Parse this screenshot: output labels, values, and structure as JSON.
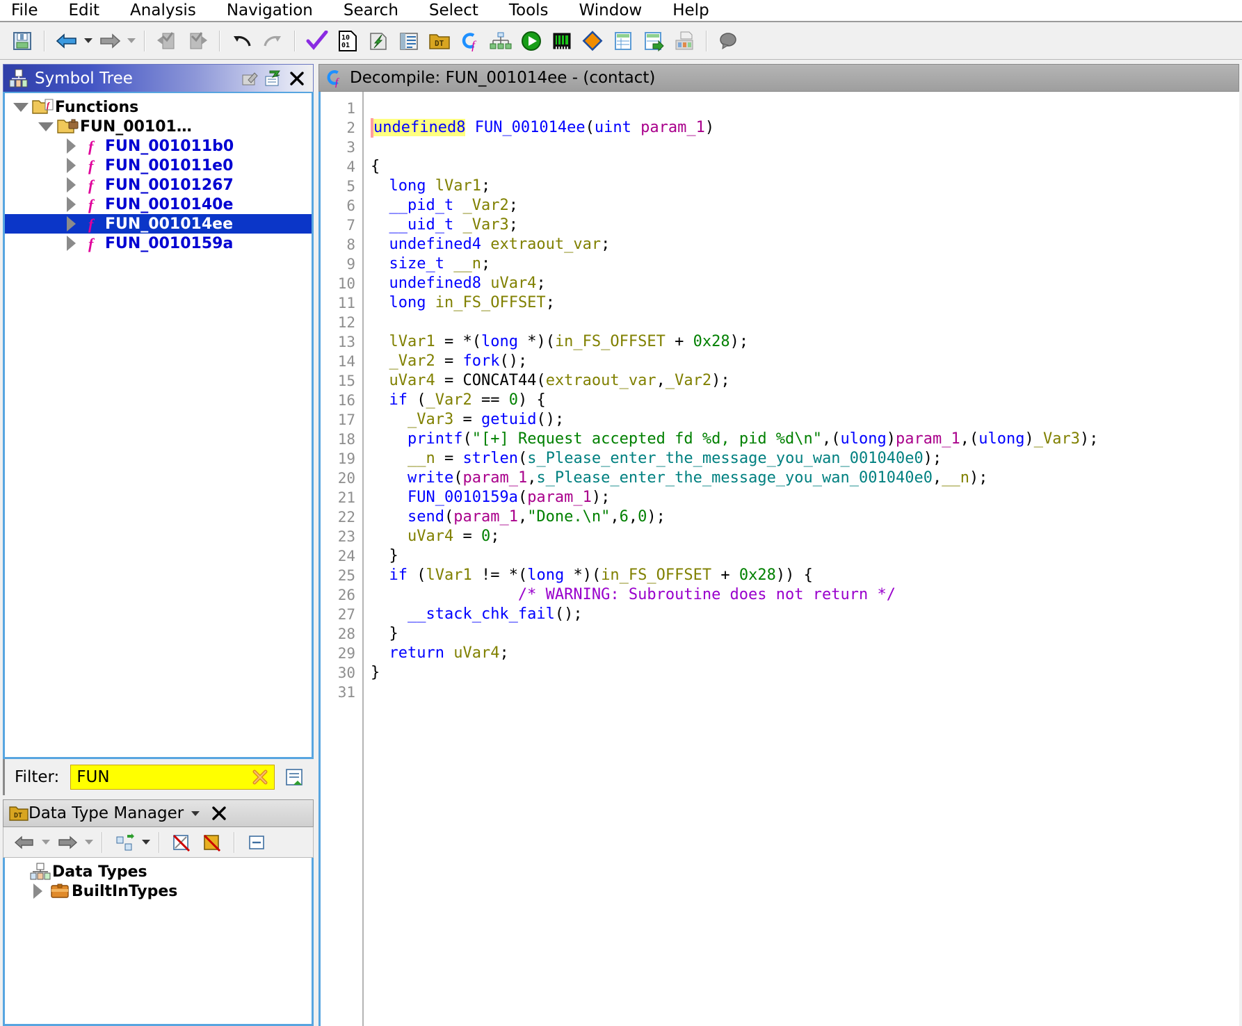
{
  "menubar": {
    "items": [
      {
        "label": "File",
        "name": "menu-file"
      },
      {
        "label": "Edit",
        "name": "menu-edit"
      },
      {
        "label": "Analysis",
        "name": "menu-analysis"
      },
      {
        "label": "Navigation",
        "name": "menu-navigation"
      },
      {
        "label": "Search",
        "name": "menu-search"
      },
      {
        "label": "Select",
        "name": "menu-select"
      },
      {
        "label": "Tools",
        "name": "menu-tools"
      },
      {
        "label": "Window",
        "name": "menu-window"
      },
      {
        "label": "Help",
        "name": "menu-help"
      }
    ]
  },
  "toolbar": {
    "icons": [
      "save-icon",
      "back-arrow-icon",
      "back-dropdown-icon",
      "forward-arrow-icon",
      "forward-dropdown-icon",
      "undo-stack-icon",
      "redo-stack-icon",
      "undo-icon",
      "redo-icon",
      "analyze-checkmark-icon",
      "binary-file-icon",
      "import-icon",
      "listing-icon",
      "data-type-manager-icon",
      "decompiler-icon",
      "function-graph-icon",
      "run-icon",
      "memory-map-icon",
      "diff-icon",
      "table-icon",
      "table-export-icon",
      "snapshot-icon",
      "comment-icon"
    ]
  },
  "symbol_tree": {
    "title": "Symbol Tree",
    "tools": [
      "edit-icon",
      "navigate-icon",
      "close-icon"
    ],
    "nodes": [
      {
        "label": "Functions",
        "name": "tree-node-functions",
        "indent": 0,
        "twist": "down",
        "icon": "folder-functions-icon",
        "kind": "folder",
        "selected": false
      },
      {
        "label": "FUN_00101…",
        "name": "tree-node-fun-00101",
        "indent": 1,
        "twist": "down",
        "icon": "folder-namespace-icon",
        "kind": "folder",
        "selected": false
      },
      {
        "label": "FUN_001011b0",
        "name": "tree-node-fun-001011b0",
        "indent": 2,
        "twist": "right",
        "icon": "function-icon",
        "kind": "function",
        "selected": false
      },
      {
        "label": "FUN_001011e0",
        "name": "tree-node-fun-001011e0",
        "indent": 2,
        "twist": "right",
        "icon": "function-icon",
        "kind": "function",
        "selected": false
      },
      {
        "label": "FUN_00101267",
        "name": "tree-node-fun-00101267",
        "indent": 2,
        "twist": "right",
        "icon": "function-icon",
        "kind": "function",
        "selected": false
      },
      {
        "label": "FUN_0010140e",
        "name": "tree-node-fun-0010140e",
        "indent": 2,
        "twist": "right",
        "icon": "function-icon",
        "kind": "function",
        "selected": false
      },
      {
        "label": "FUN_001014ee",
        "name": "tree-node-fun-001014ee",
        "indent": 2,
        "twist": "right",
        "icon": "function-icon",
        "kind": "function",
        "selected": true
      },
      {
        "label": "FUN_0010159a",
        "name": "tree-node-fun-0010159a",
        "indent": 2,
        "twist": "right",
        "icon": "function-icon",
        "kind": "function",
        "selected": false
      }
    ]
  },
  "filter": {
    "label": "Filter:",
    "value": "FUN",
    "placeholder": "",
    "clear_icon": "clear-filter-icon",
    "options_icon": "filter-options-icon"
  },
  "data_type_manager": {
    "title": "Data Type Manager",
    "tools": [
      "dropdown-icon",
      "close-icon"
    ],
    "toolbar_icons": [
      "back-arrow-icon",
      "back-dropdown-icon",
      "forward-arrow-icon",
      "forward-dropdown-icon",
      "new-category-icon",
      "new-category-dropdown-icon",
      "filter-pointers-icon",
      "filter-arrays-icon",
      "collapse-all-icon"
    ],
    "nodes": [
      {
        "label": "Data Types",
        "name": "dtm-node-data-types",
        "indent": 0,
        "twist": "none",
        "icon": "data-types-root-icon"
      },
      {
        "label": "BuiltInTypes",
        "name": "dtm-node-builtintypes",
        "indent": 1,
        "twist": "right",
        "icon": "archive-icon"
      }
    ]
  },
  "decompiler": {
    "title": "Decompile: FUN_001014ee -  (contact)",
    "icon": "decompiler-icon",
    "function_name": "FUN_001014ee",
    "program_name": "contact",
    "total_lines": 31,
    "lines": [
      {
        "n": 1,
        "tokens": []
      },
      {
        "n": 2,
        "tokens": [
          {
            "t": "caret",
            "v": " "
          },
          {
            "t": "type hl",
            "v": "undefined8"
          },
          {
            "t": "plain",
            "v": " "
          },
          {
            "t": "fn",
            "v": "FUN_001014ee"
          },
          {
            "t": "plain",
            "v": "("
          },
          {
            "t": "type",
            "v": "uint"
          },
          {
            "t": "plain",
            "v": " "
          },
          {
            "t": "param",
            "v": "param_1"
          },
          {
            "t": "plain",
            "v": ")"
          }
        ]
      },
      {
        "n": 3,
        "tokens": []
      },
      {
        "n": 4,
        "tokens": [
          {
            "t": "plain",
            "v": "{"
          }
        ]
      },
      {
        "n": 5,
        "tokens": [
          {
            "t": "plain",
            "v": "  "
          },
          {
            "t": "type",
            "v": "long"
          },
          {
            "t": "plain",
            "v": " "
          },
          {
            "t": "var",
            "v": "lVar1"
          },
          {
            "t": "plain",
            "v": ";"
          }
        ]
      },
      {
        "n": 6,
        "tokens": [
          {
            "t": "plain",
            "v": "  "
          },
          {
            "t": "type",
            "v": "__pid_t"
          },
          {
            "t": "plain",
            "v": " "
          },
          {
            "t": "var",
            "v": "_Var2"
          },
          {
            "t": "plain",
            "v": ";"
          }
        ]
      },
      {
        "n": 7,
        "tokens": [
          {
            "t": "plain",
            "v": "  "
          },
          {
            "t": "type",
            "v": "__uid_t"
          },
          {
            "t": "plain",
            "v": " "
          },
          {
            "t": "var",
            "v": "_Var3"
          },
          {
            "t": "plain",
            "v": ";"
          }
        ]
      },
      {
        "n": 8,
        "tokens": [
          {
            "t": "plain",
            "v": "  "
          },
          {
            "t": "type",
            "v": "undefined4"
          },
          {
            "t": "plain",
            "v": " "
          },
          {
            "t": "var",
            "v": "extraout_var"
          },
          {
            "t": "plain",
            "v": ";"
          }
        ]
      },
      {
        "n": 9,
        "tokens": [
          {
            "t": "plain",
            "v": "  "
          },
          {
            "t": "type",
            "v": "size_t"
          },
          {
            "t": "plain",
            "v": " "
          },
          {
            "t": "var",
            "v": "__n"
          },
          {
            "t": "plain",
            "v": ";"
          }
        ]
      },
      {
        "n": 10,
        "tokens": [
          {
            "t": "plain",
            "v": "  "
          },
          {
            "t": "type",
            "v": "undefined8"
          },
          {
            "t": "plain",
            "v": " "
          },
          {
            "t": "var",
            "v": "uVar4"
          },
          {
            "t": "plain",
            "v": ";"
          }
        ]
      },
      {
        "n": 11,
        "tokens": [
          {
            "t": "plain",
            "v": "  "
          },
          {
            "t": "type",
            "v": "long"
          },
          {
            "t": "plain",
            "v": " "
          },
          {
            "t": "var",
            "v": "in_FS_OFFSET"
          },
          {
            "t": "plain",
            "v": ";"
          }
        ]
      },
      {
        "n": 12,
        "tokens": []
      },
      {
        "n": 13,
        "tokens": [
          {
            "t": "plain",
            "v": "  "
          },
          {
            "t": "var",
            "v": "lVar1"
          },
          {
            "t": "plain",
            "v": " = *("
          },
          {
            "t": "type",
            "v": "long"
          },
          {
            "t": "plain",
            "v": " *)("
          },
          {
            "t": "var",
            "v": "in_FS_OFFSET"
          },
          {
            "t": "plain",
            "v": " + "
          },
          {
            "t": "num",
            "v": "0x28"
          },
          {
            "t": "plain",
            "v": ");"
          }
        ]
      },
      {
        "n": 14,
        "tokens": [
          {
            "t": "plain",
            "v": "  "
          },
          {
            "t": "var",
            "v": "_Var2"
          },
          {
            "t": "plain",
            "v": " = "
          },
          {
            "t": "fn",
            "v": "fork"
          },
          {
            "t": "plain",
            "v": "();"
          }
        ]
      },
      {
        "n": 15,
        "tokens": [
          {
            "t": "plain",
            "v": "  "
          },
          {
            "t": "var",
            "v": "uVar4"
          },
          {
            "t": "plain",
            "v": " = CONCAT44("
          },
          {
            "t": "var",
            "v": "extraout_var"
          },
          {
            "t": "plain",
            "v": ","
          },
          {
            "t": "var",
            "v": "_Var2"
          },
          {
            "t": "plain",
            "v": ");"
          }
        ]
      },
      {
        "n": 16,
        "tokens": [
          {
            "t": "plain",
            "v": "  "
          },
          {
            "t": "kw",
            "v": "if"
          },
          {
            "t": "plain",
            "v": " ("
          },
          {
            "t": "var",
            "v": "_Var2"
          },
          {
            "t": "plain",
            "v": " == "
          },
          {
            "t": "num",
            "v": "0"
          },
          {
            "t": "plain",
            "v": ") {"
          }
        ]
      },
      {
        "n": 17,
        "tokens": [
          {
            "t": "plain",
            "v": "    "
          },
          {
            "t": "var",
            "v": "_Var3"
          },
          {
            "t": "plain",
            "v": " = "
          },
          {
            "t": "fn",
            "v": "getuid"
          },
          {
            "t": "plain",
            "v": "();"
          }
        ]
      },
      {
        "n": 18,
        "tokens": [
          {
            "t": "plain",
            "v": "    "
          },
          {
            "t": "fn",
            "v": "printf"
          },
          {
            "t": "plain",
            "v": "("
          },
          {
            "t": "str",
            "v": "\"[+] Request accepted fd %d, pid %d\\n\""
          },
          {
            "t": "plain",
            "v": ",("
          },
          {
            "t": "type",
            "v": "ulong"
          },
          {
            "t": "plain",
            "v": ")"
          },
          {
            "t": "param",
            "v": "param_1"
          },
          {
            "t": "plain",
            "v": ",("
          },
          {
            "t": "type",
            "v": "ulong"
          },
          {
            "t": "plain",
            "v": ")"
          },
          {
            "t": "var",
            "v": "_Var3"
          },
          {
            "t": "plain",
            "v": ");"
          }
        ]
      },
      {
        "n": 19,
        "tokens": [
          {
            "t": "plain",
            "v": "    "
          },
          {
            "t": "var",
            "v": "__n"
          },
          {
            "t": "plain",
            "v": " = "
          },
          {
            "t": "fn",
            "v": "strlen"
          },
          {
            "t": "plain",
            "v": "("
          },
          {
            "t": "sym",
            "v": "s_Please_enter_the_message_you_wan_001040e0"
          },
          {
            "t": "plain",
            "v": ");"
          }
        ]
      },
      {
        "n": 20,
        "tokens": [
          {
            "t": "plain",
            "v": "    "
          },
          {
            "t": "fn",
            "v": "write"
          },
          {
            "t": "plain",
            "v": "("
          },
          {
            "t": "param",
            "v": "param_1"
          },
          {
            "t": "plain",
            "v": ","
          },
          {
            "t": "sym",
            "v": "s_Please_enter_the_message_you_wan_001040e0"
          },
          {
            "t": "plain",
            "v": ","
          },
          {
            "t": "var",
            "v": "__n"
          },
          {
            "t": "plain",
            "v": ");"
          }
        ]
      },
      {
        "n": 21,
        "tokens": [
          {
            "t": "plain",
            "v": "    "
          },
          {
            "t": "fn",
            "v": "FUN_0010159a"
          },
          {
            "t": "plain",
            "v": "("
          },
          {
            "t": "param",
            "v": "param_1"
          },
          {
            "t": "plain",
            "v": ");"
          }
        ]
      },
      {
        "n": 22,
        "tokens": [
          {
            "t": "plain",
            "v": "    "
          },
          {
            "t": "fn",
            "v": "send"
          },
          {
            "t": "plain",
            "v": "("
          },
          {
            "t": "param",
            "v": "param_1"
          },
          {
            "t": "plain",
            "v": ","
          },
          {
            "t": "str",
            "v": "\"Done.\\n\""
          },
          {
            "t": "plain",
            "v": ","
          },
          {
            "t": "num",
            "v": "6"
          },
          {
            "t": "plain",
            "v": ","
          },
          {
            "t": "num",
            "v": "0"
          },
          {
            "t": "plain",
            "v": ");"
          }
        ]
      },
      {
        "n": 23,
        "tokens": [
          {
            "t": "plain",
            "v": "    "
          },
          {
            "t": "var",
            "v": "uVar4"
          },
          {
            "t": "plain",
            "v": " = "
          },
          {
            "t": "num",
            "v": "0"
          },
          {
            "t": "plain",
            "v": ";"
          }
        ]
      },
      {
        "n": 24,
        "tokens": [
          {
            "t": "plain",
            "v": "  }"
          }
        ]
      },
      {
        "n": 25,
        "tokens": [
          {
            "t": "plain",
            "v": "  "
          },
          {
            "t": "kw",
            "v": "if"
          },
          {
            "t": "plain",
            "v": " ("
          },
          {
            "t": "var",
            "v": "lVar1"
          },
          {
            "t": "plain",
            "v": " != *("
          },
          {
            "t": "type",
            "v": "long"
          },
          {
            "t": "plain",
            "v": " *)("
          },
          {
            "t": "var",
            "v": "in_FS_OFFSET"
          },
          {
            "t": "plain",
            "v": " + "
          },
          {
            "t": "num",
            "v": "0x28"
          },
          {
            "t": "plain",
            "v": ")) {"
          }
        ]
      },
      {
        "n": 26,
        "tokens": [
          {
            "t": "plain",
            "v": "                "
          },
          {
            "t": "cmt",
            "v": "/* WARNING: Subroutine does not return */"
          }
        ]
      },
      {
        "n": 27,
        "tokens": [
          {
            "t": "plain",
            "v": "    "
          },
          {
            "t": "fn",
            "v": "__stack_chk_fail"
          },
          {
            "t": "plain",
            "v": "();"
          }
        ]
      },
      {
        "n": 28,
        "tokens": [
          {
            "t": "plain",
            "v": "  }"
          }
        ]
      },
      {
        "n": 29,
        "tokens": [
          {
            "t": "plain",
            "v": "  "
          },
          {
            "t": "kw",
            "v": "return"
          },
          {
            "t": "plain",
            "v": " "
          },
          {
            "t": "var",
            "v": "uVar4"
          },
          {
            "t": "plain",
            "v": ";"
          }
        ]
      },
      {
        "n": 30,
        "tokens": [
          {
            "t": "plain",
            "v": "}"
          }
        ]
      },
      {
        "n": 31,
        "tokens": []
      }
    ]
  },
  "colors": {
    "type": "#0000ff",
    "variable": "#808000",
    "string": "#008000",
    "comment": "#9900cc",
    "symbol": "#008080",
    "parameter": "#a9008b",
    "selection": "#0b36c8",
    "highlight": "#ffff80",
    "filter_background": "#ffff00",
    "panel_border": "#57a5e0"
  }
}
